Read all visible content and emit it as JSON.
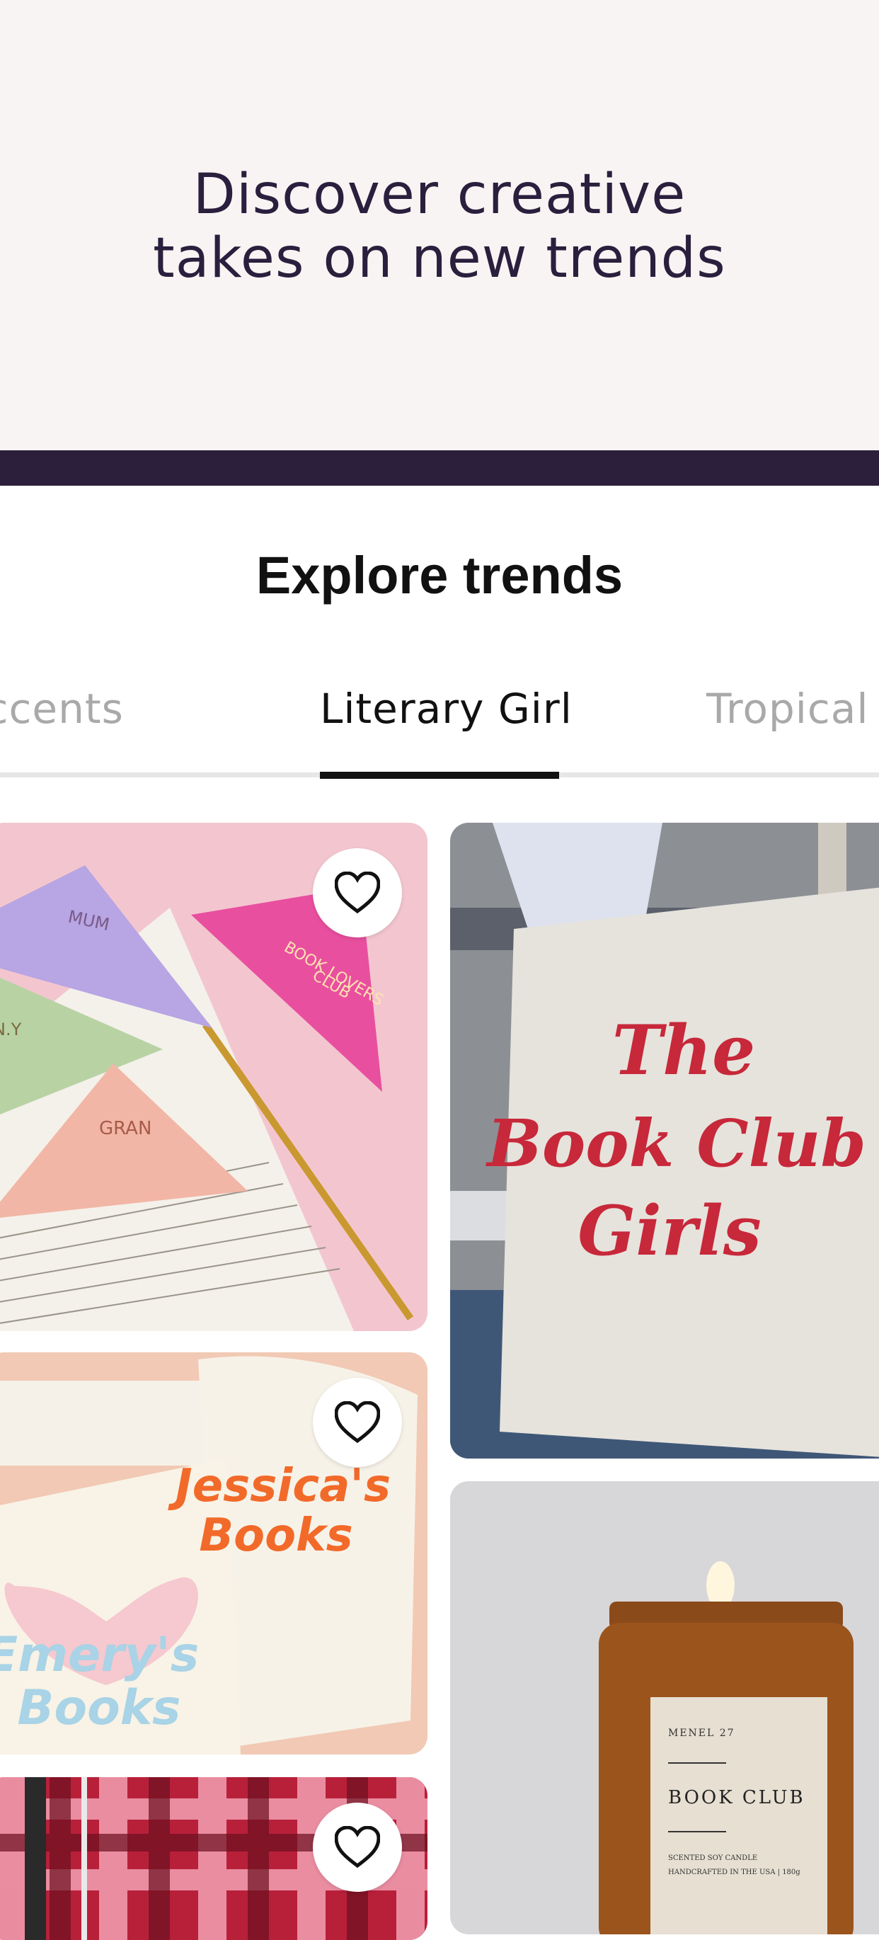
{
  "hero": {
    "title": "Discover creative\ntakes on new trends"
  },
  "section": {
    "title": "Explore trends"
  },
  "tabs": [
    {
      "label": "Accents",
      "active": false
    },
    {
      "label": "Literary Girl",
      "active": true
    },
    {
      "label": "Tropical",
      "active": false
    }
  ],
  "products": [
    {
      "labels": [
        "MUM",
        "BOOK LOVERS",
        "CLUB",
        "N.Y",
        "GRAN"
      ],
      "favorite": false
    },
    {
      "labels": [
        "The",
        "Book Club",
        "Girls"
      ]
    },
    {
      "labels": [
        "Jessica's",
        "Books",
        "Emery's",
        "Books"
      ],
      "favorite": false
    },
    {
      "labels": [
        "MENEL 27",
        "BOOK CLUB",
        "SCENTED SOY CANDLE",
        "HANDCRAFTED IN THE USA | 180g"
      ]
    },
    {
      "favorite": false
    }
  ],
  "colors": {
    "dark_band": "#2b1f3b",
    "hero_bg": "#f8f4f3",
    "accent_text": "#2a1f3d"
  }
}
